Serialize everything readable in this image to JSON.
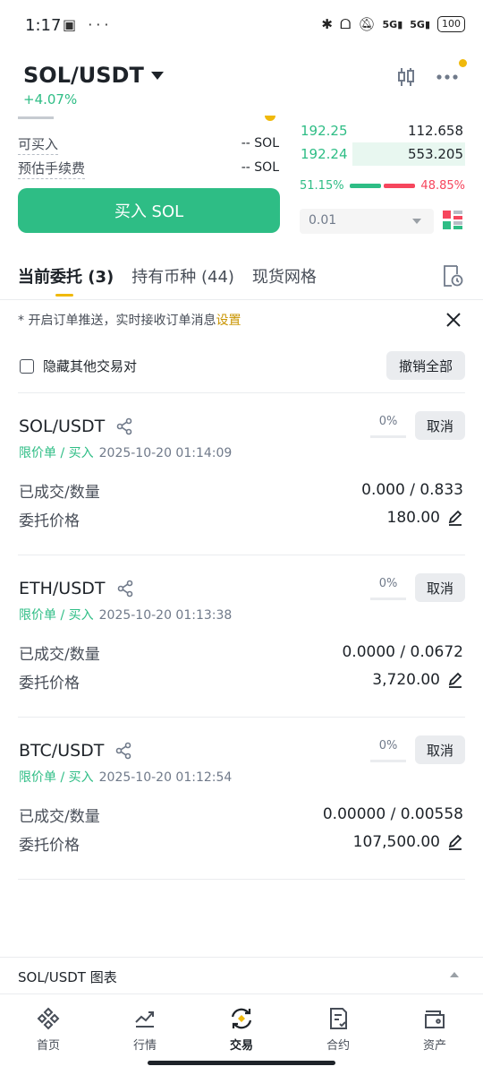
{
  "status_bar": {
    "time": "1:17",
    "left_icons": "▣ ···",
    "signal_1": "5G",
    "signal_2": "5G",
    "battery": "100"
  },
  "header": {
    "pair": "SOL/USDT",
    "change": "+4.07%",
    "icons": [
      "candlestick-chart-icon",
      "more-icon"
    ]
  },
  "form": {
    "available_label": "可买入",
    "available_value": "-- SOL",
    "fee_label": "预估手续费",
    "fee_value": "-- SOL",
    "buy_button": "买入 SOL"
  },
  "order_book": {
    "rows": [
      {
        "price": "192.25",
        "qty": "112.658",
        "depth": 0.0
      },
      {
        "price": "192.24",
        "qty": "553.205",
        "depth": 0.68
      }
    ],
    "buy_ratio": "51.15%",
    "sell_ratio": "48.85%",
    "precision": "0.01"
  },
  "tabs": [
    {
      "label": "当前委托 (3)",
      "active": true
    },
    {
      "label": "持有币种 (44)",
      "active": false
    },
    {
      "label": "现货网格",
      "active": false
    }
  ],
  "notice": {
    "text": "* 开启订单推送，实时接收订单消息",
    "link": "设置"
  },
  "filter": {
    "hide_label": "隐藏其他交易对",
    "cancel_all": "撤销全部"
  },
  "orders": [
    {
      "pair": "SOL/USDT",
      "type": "限价单 / 买入",
      "time": "2025-10-20 01:14:09",
      "progress": "0%",
      "cancel": "取消",
      "filled_label": "已成交/数量",
      "filled_value": "0.000 / 0.833",
      "price_label": "委托价格",
      "price_value": "180.00"
    },
    {
      "pair": "ETH/USDT",
      "type": "限价单 / 买入",
      "time": "2025-10-20 01:13:38",
      "progress": "0%",
      "cancel": "取消",
      "filled_label": "已成交/数量",
      "filled_value": "0.0000 / 0.0672",
      "price_label": "委托价格",
      "price_value": "3,720.00"
    },
    {
      "pair": "BTC/USDT",
      "type": "限价单 / 买入",
      "time": "2025-10-20 01:12:54",
      "progress": "0%",
      "cancel": "取消",
      "filled_label": "已成交/数量",
      "filled_value": "0.00000 / 0.00558",
      "price_label": "委托价格",
      "price_value": "107,500.00"
    }
  ],
  "chart_strip": {
    "label": "SOL/USDT 图表"
  },
  "bottom_nav": [
    {
      "label": "首页",
      "icon": "home-icon"
    },
    {
      "label": "行情",
      "icon": "markets-icon"
    },
    {
      "label": "交易",
      "icon": "trade-icon",
      "active": true
    },
    {
      "label": "合约",
      "icon": "futures-icon"
    },
    {
      "label": "资产",
      "icon": "wallet-icon"
    }
  ],
  "colors": {
    "green": "#2ebd85",
    "red": "#f6465d",
    "accent": "#f0b90b"
  }
}
